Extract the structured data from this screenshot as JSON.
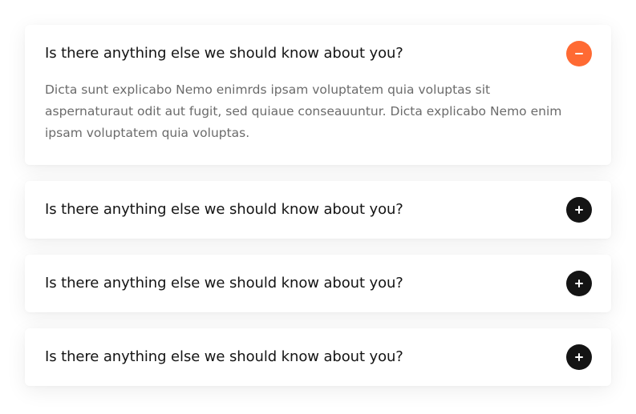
{
  "colors": {
    "accent": "#ff6a33",
    "toggle_closed": "#141414",
    "question_text": "#141414",
    "answer_text": "#6b6b6b"
  },
  "faq": {
    "items": [
      {
        "question": "Is there anything else we should know about you?",
        "answer": "Dicta sunt explicabo Nemo enimrds ipsam voluptatem quia voluptas sit aspernaturaut odit aut fugit, sed quiaue conseauuntur. Dicta explicabo Nemo enim ipsam voluptatem quia voluptas.",
        "expanded": true,
        "toggle_icon": "minus-icon"
      },
      {
        "question": "Is there anything else we should know about you?",
        "expanded": false,
        "toggle_icon": "plus-icon"
      },
      {
        "question": "Is there anything else we should know about you?",
        "expanded": false,
        "toggle_icon": "plus-icon"
      },
      {
        "question": "Is there anything else we should know about you?",
        "expanded": false,
        "toggle_icon": "plus-icon"
      }
    ]
  }
}
